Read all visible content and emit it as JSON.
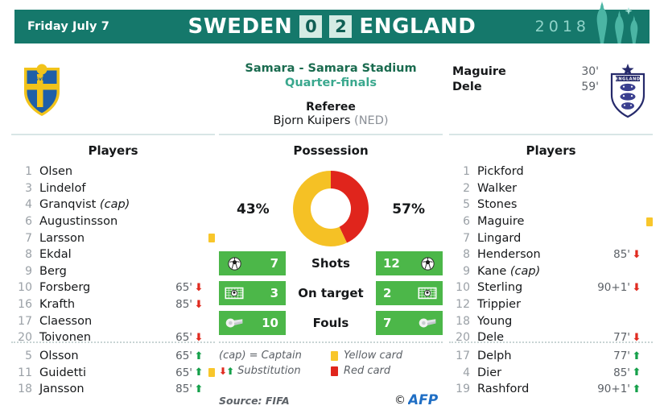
{
  "header": {
    "date": "Friday July 7",
    "home_team": "SWEDEN",
    "home_score": "0",
    "away_score": "2",
    "away_team": "ENGLAND",
    "year": "2018",
    "domes_icon": "kremlin-domes-icon"
  },
  "match_info": {
    "venue": "Samara - Samara Stadium",
    "round": "Quarter-finals",
    "referee_label": "Referee",
    "referee_name": "Bjorn Kuipers",
    "referee_country": "(NED)"
  },
  "badges": {
    "home_badge_icon": "sweden-crest-icon",
    "home_badge_text": "SvFF",
    "away_badge_icon": "england-crest-icon",
    "away_badge_text": "ENGLAND"
  },
  "scorers": [
    {
      "name": "Maguire",
      "time": "30'"
    },
    {
      "name": "Dele",
      "time": "59'"
    }
  ],
  "columns": {
    "home_title": "Players",
    "possession_title": "Possession",
    "away_title": "Players"
  },
  "home_starters": [
    {
      "num": "1",
      "name": "Olsen",
      "cap": "",
      "time": "",
      "arrow": "",
      "card": ""
    },
    {
      "num": "3",
      "name": "Lindelof",
      "cap": "",
      "time": "",
      "arrow": "",
      "card": ""
    },
    {
      "num": "4",
      "name": "Granqvist",
      "cap": "(cap)",
      "time": "",
      "arrow": "",
      "card": ""
    },
    {
      "num": "6",
      "name": "Augustinsson",
      "cap": "",
      "time": "",
      "arrow": "",
      "card": ""
    },
    {
      "num": "7",
      "name": "Larsson",
      "cap": "",
      "time": "",
      "arrow": "",
      "card": "yellow"
    },
    {
      "num": "8",
      "name": "Ekdal",
      "cap": "",
      "time": "",
      "arrow": "",
      "card": ""
    },
    {
      "num": "9",
      "name": "Berg",
      "cap": "",
      "time": "",
      "arrow": "",
      "card": ""
    },
    {
      "num": "10",
      "name": "Forsberg",
      "cap": "",
      "time": "65'",
      "arrow": "out",
      "card": ""
    },
    {
      "num": "16",
      "name": "Krafth",
      "cap": "",
      "time": "85'",
      "arrow": "out",
      "card": ""
    },
    {
      "num": "17",
      "name": "Claesson",
      "cap": "",
      "time": "",
      "arrow": "",
      "card": ""
    },
    {
      "num": "20",
      "name": "Toivonen",
      "cap": "",
      "time": "65'",
      "arrow": "out",
      "card": ""
    }
  ],
  "home_subs": [
    {
      "num": "5",
      "name": "Olsson",
      "cap": "",
      "time": "65'",
      "arrow": "in",
      "card": ""
    },
    {
      "num": "11",
      "name": "Guidetti",
      "cap": "",
      "time": "65'",
      "arrow": "in",
      "card": "yellow"
    },
    {
      "num": "18",
      "name": "Jansson",
      "cap": "",
      "time": "85'",
      "arrow": "in",
      "card": ""
    }
  ],
  "away_starters": [
    {
      "num": "1",
      "name": "Pickford",
      "cap": "",
      "time": "",
      "arrow": "",
      "card": ""
    },
    {
      "num": "2",
      "name": "Walker",
      "cap": "",
      "time": "",
      "arrow": "",
      "card": ""
    },
    {
      "num": "5",
      "name": "Stones",
      "cap": "",
      "time": "",
      "arrow": "",
      "card": ""
    },
    {
      "num": "6",
      "name": "Maguire",
      "cap": "",
      "time": "",
      "arrow": "",
      "card": "yellow"
    },
    {
      "num": "7",
      "name": "Lingard",
      "cap": "",
      "time": "",
      "arrow": "",
      "card": ""
    },
    {
      "num": "8",
      "name": "Henderson",
      "cap": "",
      "time": "85'",
      "arrow": "out",
      "card": ""
    },
    {
      "num": "9",
      "name": "Kane",
      "cap": "(cap)",
      "time": "",
      "arrow": "",
      "card": ""
    },
    {
      "num": "10",
      "name": "Sterling",
      "cap": "",
      "time": "90+1'",
      "arrow": "out",
      "card": ""
    },
    {
      "num": "12",
      "name": "Trippier",
      "cap": "",
      "time": "",
      "arrow": "",
      "card": ""
    },
    {
      "num": "18",
      "name": "Young",
      "cap": "",
      "time": "",
      "arrow": "",
      "card": ""
    },
    {
      "num": "20",
      "name": "Dele",
      "cap": "",
      "time": "77'",
      "arrow": "out",
      "card": ""
    }
  ],
  "away_subs": [
    {
      "num": "17",
      "name": "Delph",
      "cap": "",
      "time": "77'",
      "arrow": "in",
      "card": ""
    },
    {
      "num": "4",
      "name": "Dier",
      "cap": "",
      "time": "85'",
      "arrow": "in",
      "card": ""
    },
    {
      "num": "19",
      "name": "Rashford",
      "cap": "",
      "time": "90+1'",
      "arrow": "in",
      "card": ""
    }
  ],
  "chart_data": {
    "type": "pie",
    "title": "Possession",
    "categories": [
      "Sweden",
      "England"
    ],
    "values": [
      43,
      57
    ],
    "labels": [
      "43%",
      "57%"
    ],
    "colors": [
      "#e0251c",
      "#f5c125"
    ],
    "legend": "inline-sides",
    "unit": "%"
  },
  "stats": [
    {
      "label": "Shots",
      "home": "7",
      "away": "12",
      "icon": "football-icon"
    },
    {
      "label": "On target",
      "home": "3",
      "away": "2",
      "icon": "goal-net-icon"
    },
    {
      "label": "Fouls",
      "home": "10",
      "away": "7",
      "icon": "whistle-icon"
    }
  ],
  "legend": {
    "captain": "(cap) = Captain",
    "substitution": "Substitution",
    "yellow_card": "Yellow card",
    "red_card": "Red card"
  },
  "footer": {
    "source": "Source: FIFA",
    "copyright": "©",
    "agency": "AFP"
  },
  "colors": {
    "header_green": "#15786b",
    "stat_green": "#4cb749",
    "yellow": "#f8c62b",
    "red": "#e0251c",
    "sub_in": "#15a04a",
    "sub_out": "#e02b20",
    "venue": "#1a6b4f",
    "round": "#3aa88e",
    "afp_blue": "#1f6ec4"
  }
}
